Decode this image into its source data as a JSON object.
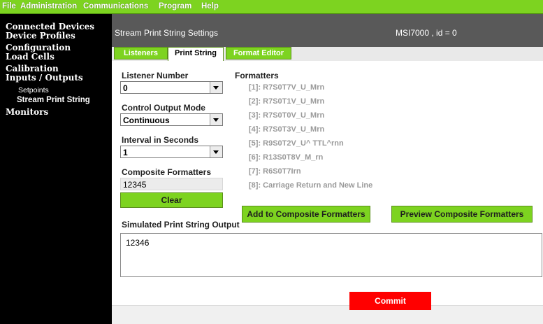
{
  "menu": [
    "File",
    "Administration",
    "Communications",
    "Program",
    "Help"
  ],
  "sidebar": {
    "items": [
      "Connected Devices",
      "Device Profiles",
      "Configuration",
      "Load Cells",
      "Calibration",
      "Inputs / Outputs"
    ],
    "subitems": [
      "Setpoints",
      "Stream Print String"
    ],
    "last": "Monitors"
  },
  "header": {
    "title": "Stream Print String Settings",
    "device": "MSI7000 , id = 0"
  },
  "tabs": [
    "Listeners",
    "Print String",
    "Format Editor"
  ],
  "form": {
    "listener_label": "Listener Number",
    "listener_value": "0",
    "mode_label": "Control Output Mode",
    "mode_value": "Continuous",
    "interval_label": "Interval in Seconds",
    "interval_value": "1",
    "composite_label": "Composite Formatters",
    "composite_value": "12345",
    "clear": "Clear"
  },
  "formatters": {
    "title": "Formatters",
    "items": [
      "[1]: R7S0T7V_U_Mrn",
      "[2]: R7S0T1V_U_Mrn",
      "[3]: R7S0T0V_U_Mrn",
      "[4]: R7S0T3V_U_Mrn",
      "[5]: R9S0T2V_U^ TTL^rnn",
      "[6]: R13S0T8V_M_rn",
      "[7]: R6S0T7Irn",
      "[8]: Carriage Return and New Line"
    ]
  },
  "buttons": {
    "add": "Add to Composite Formatters",
    "preview": "Preview Composite Formatters",
    "commit": "Commit"
  },
  "output": {
    "label": "Simulated Print String Output",
    "value": "12346"
  },
  "colors": {
    "accent": "#7dd320",
    "header": "#595959",
    "commit": "#ff0000"
  }
}
